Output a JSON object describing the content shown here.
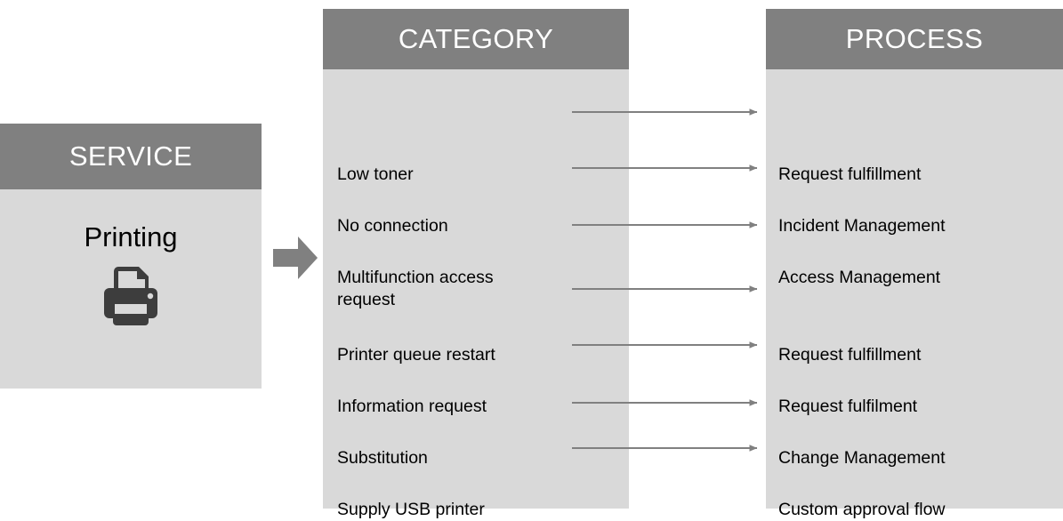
{
  "service": {
    "header_label": "SERVICE",
    "name": "Printing",
    "icon": "printer-icon"
  },
  "flow_arrow": {
    "icon": "right-block-arrow-icon",
    "color": "#808080"
  },
  "category": {
    "header_label": "CATEGORY",
    "items": [
      {
        "label": "Low toner"
      },
      {
        "label": "No connection"
      },
      {
        "label": "Multifunction access\nrequest"
      },
      {
        "label": "Printer queue restart"
      },
      {
        "label": "Information request"
      },
      {
        "label": "Substitution"
      },
      {
        "label": "Supply USB printer"
      }
    ]
  },
  "process": {
    "header_label": "PROCESS",
    "items": [
      {
        "label": "Request fulfillment"
      },
      {
        "label": "Incident Management"
      },
      {
        "label": "Access Management"
      },
      {
        "label": "Request fulfillment"
      },
      {
        "label": "Request fulfilment"
      },
      {
        "label": "Change Management"
      },
      {
        "label": "Custom approval flow"
      }
    ]
  },
  "connectors": {
    "icon": "right-arrow-icon",
    "count": 7,
    "color": "#808080",
    "mappings": [
      {
        "from": "Low toner",
        "to": "Request fulfillment"
      },
      {
        "from": "No connection",
        "to": "Incident Management"
      },
      {
        "from": "Multifunction access request",
        "to": "Access Management"
      },
      {
        "from": "Printer queue restart",
        "to": "Request fulfillment"
      },
      {
        "from": "Information request",
        "to": "Request fulfilment"
      },
      {
        "from": "Substitution",
        "to": "Change Management"
      },
      {
        "from": "Supply USB printer",
        "to": "Custom approval flow"
      }
    ]
  },
  "colors": {
    "header_gray": "#808080",
    "body_gray": "#d9d9d9",
    "text_dark": "#000000",
    "icon_dark": "#3d3d3d",
    "background": "#ffffff"
  }
}
